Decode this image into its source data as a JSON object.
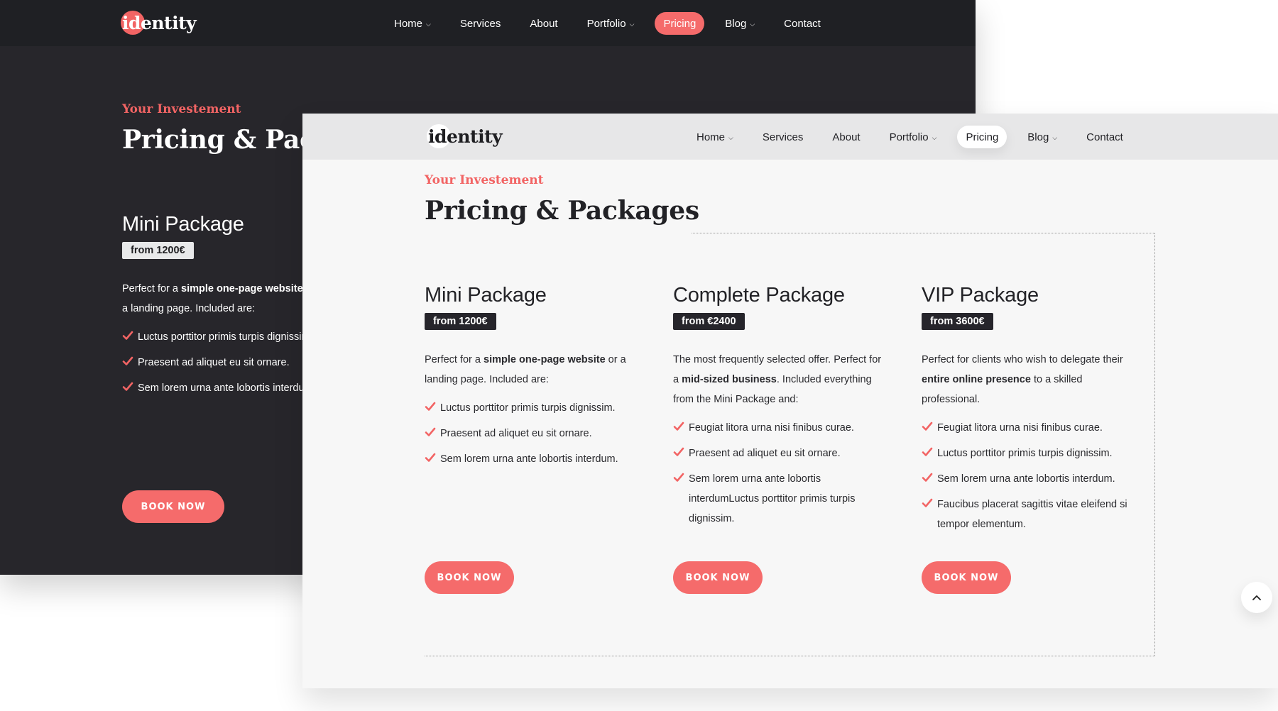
{
  "brand": {
    "logo_text": "identity",
    "accent": "#f56b6b",
    "dark_bg": "#27262b",
    "light_bg": "#f7f7f7"
  },
  "nav": {
    "items": [
      {
        "label": "Home",
        "dropdown": true
      },
      {
        "label": "Services",
        "dropdown": false
      },
      {
        "label": "About",
        "dropdown": false
      },
      {
        "label": "Portfolio",
        "dropdown": true
      },
      {
        "label": "Pricing",
        "dropdown": false,
        "active": true
      },
      {
        "label": "Blog",
        "dropdown": true
      },
      {
        "label": "Contact",
        "dropdown": false
      }
    ],
    "chevron_glyph": "⌄"
  },
  "section": {
    "eyebrow": "Your Investement",
    "title": "Pricing & Packages"
  },
  "packages": [
    {
      "name": "Mini Package",
      "price": "from 1200€",
      "desc_pre": "Perfect for a ",
      "desc_bold": "simple one-page website",
      "desc_post": " or a landing page. Included are:",
      "features": [
        "Luctus porttitor primis turpis dignissim.",
        "Praesent ad aliquet eu sit ornare.",
        "Sem lorem urna ante lobortis interdum."
      ],
      "button": "BOOK NOW"
    },
    {
      "name": "Complete Package",
      "price": "from €2400",
      "desc_pre": "The most frequently selected offer. Perfect for a ",
      "desc_bold": "mid-sized business",
      "desc_post": ". Included everything from the Mini Package and:",
      "features": [
        "Feugiat litora urna nisi finibus curae.",
        "Praesent ad aliquet eu sit ornare.",
        "Sem lorem urna ante lobortis interdumLuctus porttitor primis turpis dignissim."
      ],
      "button": "BOOK NOW"
    },
    {
      "name": "VIP Package",
      "price": "from 3600€",
      "desc_pre": "Perfect for clients who wish to delegate their ",
      "desc_bold": "entire online presence",
      "desc_post": " to a skilled professional.",
      "features": [
        "Feugiat litora urna nisi finibus curae.",
        "Luctus porttitor primis turpis dignissim.",
        "Sem lorem urna ante lobortis interdum.",
        "Faucibus placerat sagittis vitae eleifend si tempor elementum."
      ],
      "button": "BOOK NOW"
    }
  ],
  "scroll_top": {
    "icon": "chevron-up-icon"
  }
}
